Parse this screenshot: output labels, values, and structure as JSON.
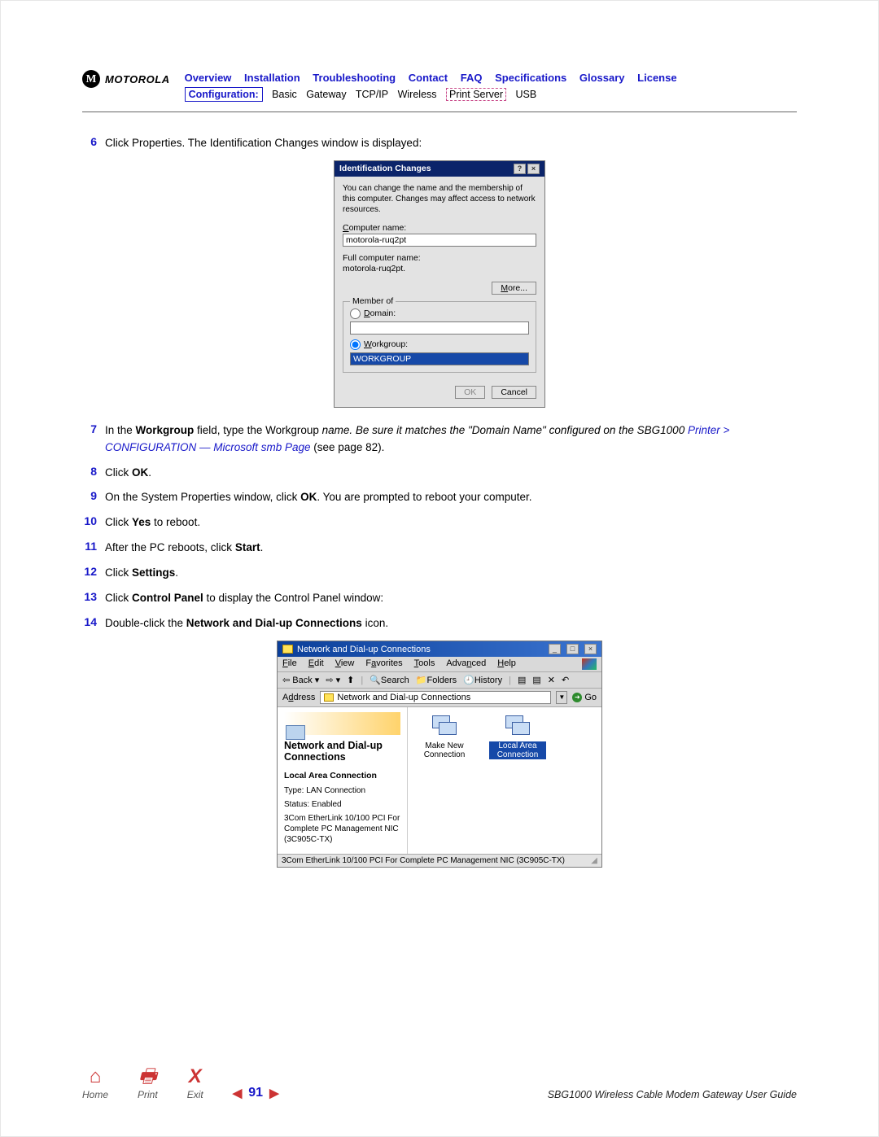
{
  "header": {
    "brand": "MOTOROLA",
    "top_links": [
      "Overview",
      "Installation",
      "Troubleshooting",
      "Contact",
      "FAQ",
      "Specifications",
      "Glossary",
      "License"
    ],
    "config_label": "Configuration:",
    "sub_links": [
      "Basic",
      "Gateway",
      "TCP/IP",
      "Wireless",
      "Print Server",
      "USB"
    ]
  },
  "steps": {
    "s6": {
      "num": "6",
      "text": "Click Properties. The Identification Changes window is displayed:"
    },
    "s7": {
      "num": "7",
      "pre": "In the ",
      "b1": "Workgroup",
      "mid": " field, type the Workgroup ",
      "i1": "name. Be sure it matches the \"Domain Name\" configured on the SBG1000 ",
      "link": "Printer > CONFIGURATION — Microsoft smb Page",
      "post": " (see page 82)."
    },
    "s8": {
      "num": "8",
      "pre": "Click ",
      "b": "OK",
      "post": "."
    },
    "s9": {
      "num": "9",
      "pre": "On the System Properties window, click ",
      "b": "OK",
      "post": ". You are prompted to reboot your computer."
    },
    "s10": {
      "num": "10",
      "pre": "Click ",
      "b": "Yes",
      "post": " to reboot."
    },
    "s11": {
      "num": "11",
      "pre": "After the PC reboots, click ",
      "b": "Start",
      "post": "."
    },
    "s12": {
      "num": "12",
      "pre": "Click ",
      "b": "Settings",
      "post": "."
    },
    "s13": {
      "num": "13",
      "pre": "Click ",
      "b": "Control Panel",
      "post": " to display the Control Panel window:"
    },
    "s14": {
      "num": "14",
      "pre": "Double-click the ",
      "b": "Network and Dial-up Connections",
      "post": " icon."
    }
  },
  "dlg": {
    "title": "Identification Changes",
    "desc": "You can change the name and the membership of this computer. Changes may affect access to network resources.",
    "lbl_computer": "Computer name:",
    "val_computer": "motorola-ruq2pt",
    "lbl_full": "Full computer name:",
    "val_full": "motorola-ruq2pt.",
    "btn_more": "More...",
    "grp_member": "Member of",
    "radio_domain": "Domain:",
    "radio_workgroup": "Workgroup:",
    "val_workgroup": "WORKGROUP",
    "btn_ok": "OK",
    "btn_cancel": "Cancel"
  },
  "explorer": {
    "title": "Network and Dial-up Connections",
    "menu": [
      "File",
      "Edit",
      "View",
      "Favorites",
      "Tools",
      "Advanced",
      "Help"
    ],
    "tb": {
      "back": "Back",
      "search": "Search",
      "folders": "Folders",
      "history": "History"
    },
    "addr_label": "Address",
    "addr_value": "Network and Dial-up Connections",
    "go": "Go",
    "left": {
      "title": "Network and Dial-up Connections",
      "h4": "Local Area Connection",
      "type_lbl": "Type: LAN Connection",
      "status_lbl": "Status: Enabled",
      "nic": "3Com EtherLink 10/100 PCI For Complete PC Management NIC (3C905C-TX)"
    },
    "items": {
      "make": "Make New Connection",
      "lan": "Local Area Connection"
    },
    "status": "3Com EtherLink 10/100 PCI For Complete PC Management NIC (3C905C-TX)"
  },
  "footer": {
    "home": "Home",
    "print": "Print",
    "exit": "Exit",
    "page": "91",
    "title": "SBG1000 Wireless Cable Modem Gateway User Guide"
  }
}
